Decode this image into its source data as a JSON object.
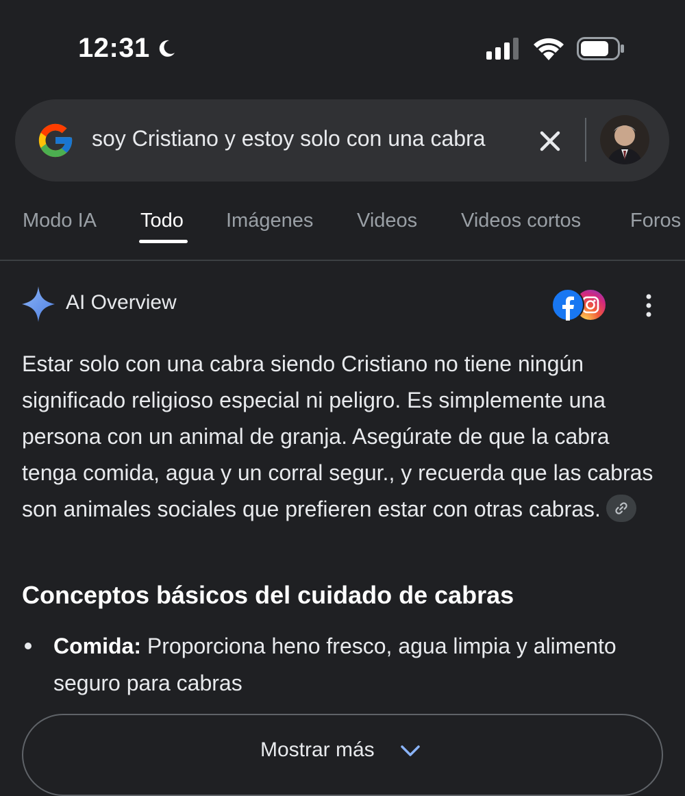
{
  "status_bar": {
    "time": "12:31",
    "moon_icon": "moon-icon",
    "signal_icon": "cellular-signal-icon",
    "wifi_icon": "wifi-icon",
    "battery_icon": "battery-icon"
  },
  "search": {
    "query": "soy Cristiano y estoy solo con una cabra",
    "logo_icon": "google-g-icon",
    "clear_icon": "close-icon"
  },
  "tabs": [
    {
      "label": "Modo IA",
      "active": false
    },
    {
      "label": "Todo",
      "active": true
    },
    {
      "label": "Imágenes",
      "active": false
    },
    {
      "label": "Videos",
      "active": false
    },
    {
      "label": "Videos cortos",
      "active": false
    },
    {
      "label": "Foros",
      "active": false
    }
  ],
  "ai_overview": {
    "title": "AI Overview",
    "sparkle_icon": "sparkle-icon",
    "source_icons": [
      "facebook-icon",
      "instagram-icon"
    ],
    "more_icon": "more-vert-icon",
    "body": "Estar solo con una cabra siendo Cristiano no tiene ningún significado religioso especial ni peligro. Es simplemente una persona con un animal de  granja. Asegúrate de que la cabra tenga comida, agua y un corral segur., y recuerda que las cabras son animales sociales que prefieren estar con otras cabras.",
    "link_icon": "link-icon",
    "section_heading": "Conceptos básicos del cuidado de cabras",
    "bullets": [
      {
        "term": "Comida:",
        "text": " Proporciona heno fresco, agua limpia y alimento seguro para cabras"
      }
    ],
    "show_more_label": "Mostrar más"
  },
  "colors": {
    "background": "#1f2023",
    "search_bar": "#303134",
    "text": "#e8eaed",
    "muted_text": "#9aa0a6",
    "accent_blue": "#8ab4f8"
  }
}
